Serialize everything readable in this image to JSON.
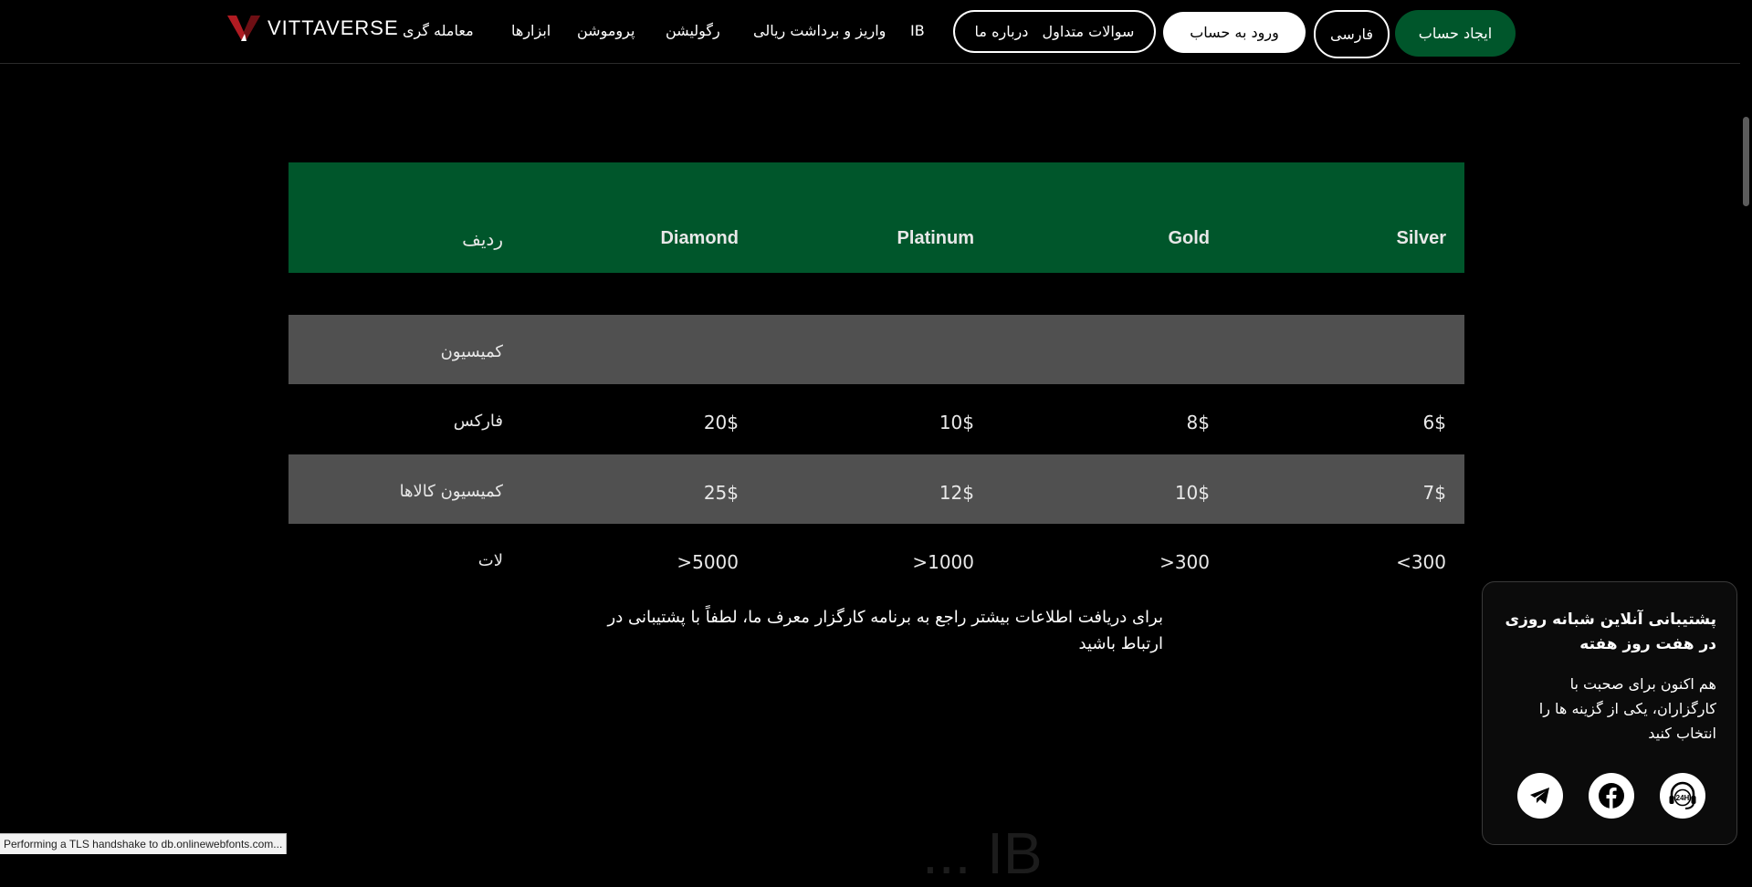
{
  "header": {
    "create_account": "ایجاد حساب",
    "language": "فارسی",
    "login": "ورود به حساب",
    "pill_links": [
      "سوالات متداول",
      "درباره ما"
    ],
    "nav": [
      "IB",
      "واریز و برداشت ریالی",
      "رگولیشن",
      "پروموشن",
      "ابزارها",
      "معامله گری"
    ],
    "logo_text": "VITTAVERSE"
  },
  "table": {
    "headers": [
      "Silver",
      "Gold",
      "Platinum",
      "Diamond",
      "ردیف"
    ],
    "rows": [
      {
        "label": "کمیسیون",
        "values": [
          "",
          "",
          "",
          ""
        ],
        "shaded": true
      },
      {
        "label": "فارکس",
        "values": [
          "6$",
          "8$",
          "10$",
          "20$"
        ],
        "shaded": false
      },
      {
        "label": "کمیسیون کالاها",
        "values": [
          "7$",
          "10$",
          "12$",
          "25$"
        ],
        "shaded": true
      },
      {
        "label": "لات",
        "values": [
          "<300",
          ">300",
          ">1000",
          ">5000"
        ],
        "shaded": false
      }
    ]
  },
  "note": "برای دریافت اطلاعات بیشتر راجع به برنامه کارگزار معرف ما، لطفاً با پشتیبانی در ارتباط باشید",
  "support": {
    "title": "پشتیبانی آنلاین شبانه روزی در هفت روز هفته",
    "text": "هم اکنون برای صحبت با کارگزاران، یکی از گزینه ها را انتخاب کنید",
    "icons": [
      "telegram-icon",
      "facebook-icon",
      "support-24h-icon"
    ],
    "support_badge": "24H"
  },
  "ghost_heading": "IB ...",
  "status_bar": "Performing a TLS handshake to db.onlinewebfonts.com...",
  "colors": {
    "brand_green": "#00562b",
    "row_shade": "#505050",
    "background": "#000000"
  }
}
